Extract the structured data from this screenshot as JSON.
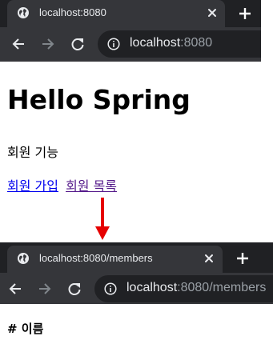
{
  "colors": {
    "chrome_dark": "#202124",
    "chrome_toolbar": "#35363a",
    "chrome_text": "#e8eaed",
    "chrome_dim": "#9aa0a6",
    "link_unvisited": "#0000ee",
    "link_visited": "#551a8b",
    "arrow": "#e60000"
  },
  "browser1": {
    "tab_title": "localhost:8080",
    "url_host": "localhost",
    "url_rest": ":8080"
  },
  "page1": {
    "heading": "Hello Spring",
    "section_text": "회원 기능",
    "link_join": "회원 가입",
    "link_list": "회원 목록"
  },
  "browser2": {
    "tab_title": "localhost:8080/members",
    "url_host": "localhost",
    "url_rest": ":8080/members"
  },
  "page2": {
    "table_header": "# 이름"
  }
}
